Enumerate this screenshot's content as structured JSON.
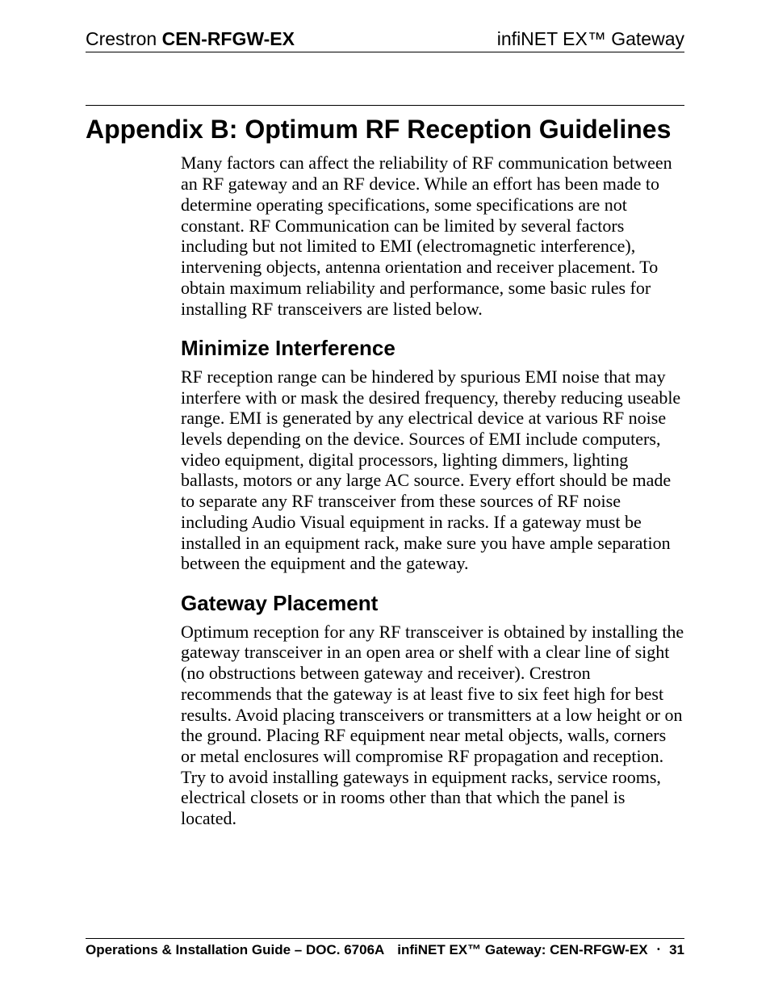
{
  "header": {
    "left_prefix": "Crestron ",
    "left_bold": "CEN-RFGW-EX",
    "right": "infiNET EX™ Gateway"
  },
  "title": "Appendix B:  Optimum RF Reception Guidelines",
  "intro": "Many factors can affect the reliability of RF communication between an RF gateway and an RF device. While an effort has been made to determine operating specifications, some specifications are not constant. RF Communication can be limited by several factors including but not limited to EMI (electromagnetic interference), intervening objects, antenna orientation and receiver placement. To obtain maximum reliability and performance, some basic rules for installing RF transceivers are listed below.",
  "sections": [
    {
      "heading": "Minimize Interference",
      "body": "RF reception range can be hindered by spurious EMI noise that may interfere with or mask the desired frequency, thereby reducing useable range. EMI is generated by any electrical device at various RF noise levels depending on the device. Sources of EMI include computers, video equipment, digital processors, lighting dimmers, lighting ballasts, motors or any large AC source. Every effort should be made to separate any RF transceiver from these sources of RF noise including Audio Visual equipment in racks. If a gateway must be installed in an equipment rack, make sure you have ample separation between the equipment and the gateway."
    },
    {
      "heading": "Gateway Placement",
      "body": "Optimum reception for any RF transceiver is obtained by installing the gateway transceiver in an open area or shelf with a clear line of sight (no obstructions between gateway and receiver). Crestron recommends that the gateway is at least five to six feet high for best results. Avoid placing transceivers or transmitters at a low height or on the ground. Placing RF equipment near metal objects, walls, corners or metal enclosures will compromise RF propagation and reception. Try to avoid installing gateways in equipment racks, service rooms, electrical closets or in rooms other than that which the panel is located."
    }
  ],
  "footer": {
    "left": "Operations & Installation Guide – DOC. 6706A",
    "right_prefix": "infiNET EX™ Gateway: CEN-RFGW-EX",
    "bullet": "•",
    "page_number": "31"
  }
}
